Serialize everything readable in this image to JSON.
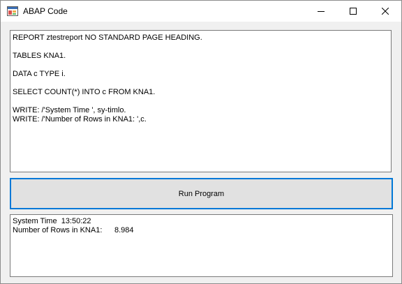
{
  "window": {
    "title": "ABAP Code"
  },
  "code": {
    "lines": [
      "REPORT ztestreport NO STANDARD PAGE HEADING.",
      "",
      "TABLES KNA1.",
      "",
      "DATA c TYPE i.",
      "",
      "SELECT COUNT(*) INTO c FROM KNA1.",
      "",
      "WRITE: /'System Time ', sy-timlo.",
      "WRITE: /'Number of Rows in KNA1: ',c."
    ]
  },
  "run_button": {
    "label": "Run Program"
  },
  "output": {
    "system_time_label": "System Time",
    "system_time_value": "13:50:22",
    "rows_label": "Number of Rows in KNA1:",
    "rows_value": "8.984"
  },
  "icons": {
    "app": "app-window-icon",
    "minimize": "minimize-icon",
    "maximize": "maximize-icon",
    "close": "close-icon"
  }
}
